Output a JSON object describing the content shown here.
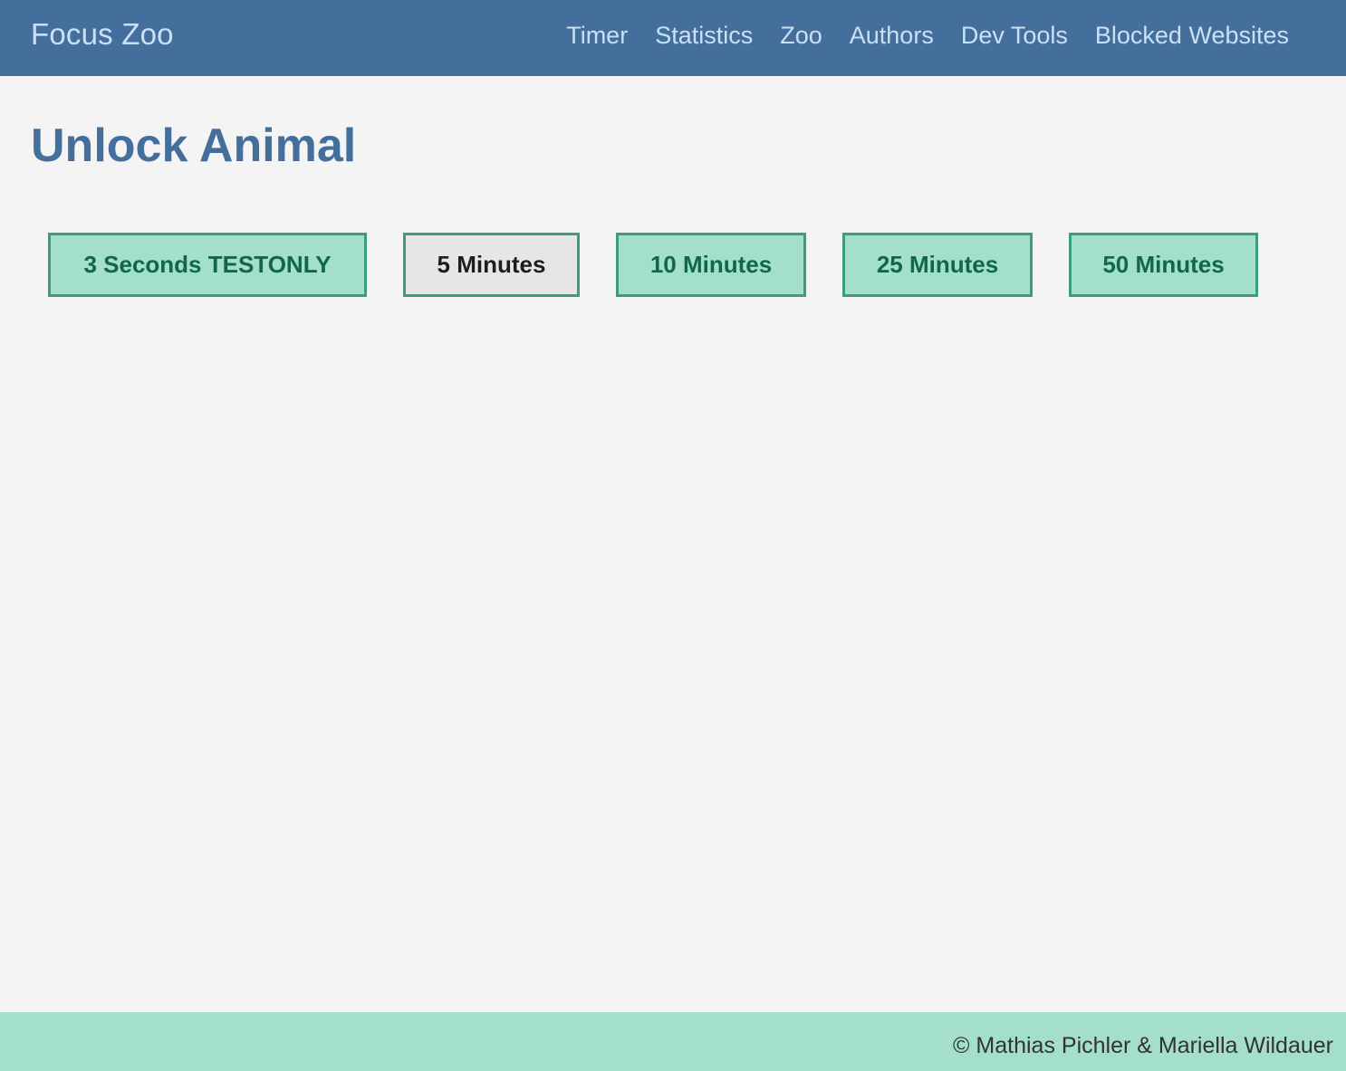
{
  "navbar": {
    "brand": "Focus Zoo",
    "links": [
      "Timer",
      "Statistics",
      "Zoo",
      "Authors",
      "Dev Tools",
      "Blocked Websites"
    ]
  },
  "main": {
    "title": "Unlock Animal",
    "buttons": [
      {
        "label": "3 Seconds TESTONLY",
        "selected": false
      },
      {
        "label": "5 Minutes",
        "selected": true
      },
      {
        "label": "10 Minutes",
        "selected": false
      },
      {
        "label": "25 Minutes",
        "selected": false
      },
      {
        "label": "50 Minutes",
        "selected": false
      }
    ]
  },
  "footer": {
    "text": "© Mathias Pichler & Mariella Wildauer"
  },
  "colors": {
    "navbar_bg": "#446e9b",
    "nav_text": "#c9e0f7",
    "button_bg": "#a3dfc9",
    "button_border": "#3d9c7b",
    "button_text": "#10674a",
    "selected_bg": "#e6e6e6",
    "footer_bg": "#a3dfc9"
  }
}
